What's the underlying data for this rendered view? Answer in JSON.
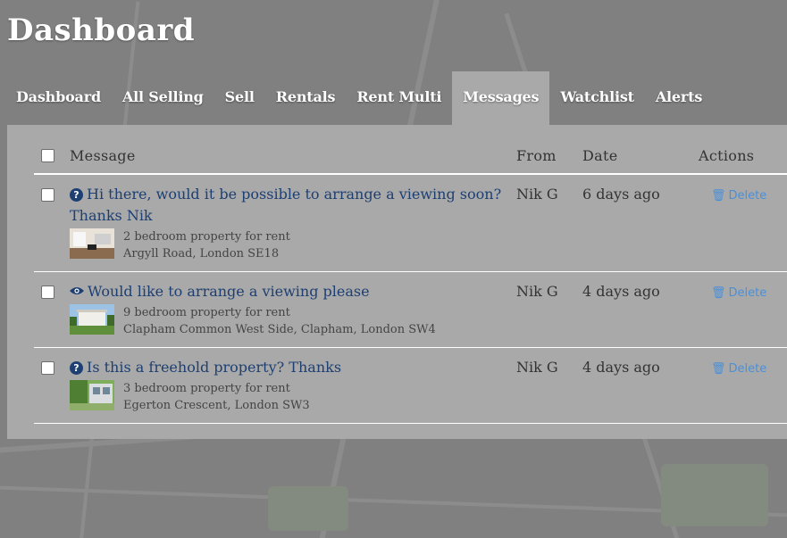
{
  "page": {
    "title": "Dashboard"
  },
  "tabs": [
    {
      "label": "Dashboard"
    },
    {
      "label": "All Selling"
    },
    {
      "label": "Sell"
    },
    {
      "label": "Rentals"
    },
    {
      "label": "Rent Multi"
    },
    {
      "label": "Messages",
      "active": true
    },
    {
      "label": "Watchlist"
    },
    {
      "label": "Alerts"
    }
  ],
  "table": {
    "headers": {
      "message": "Message",
      "from": "From",
      "date": "Date",
      "actions": "Actions"
    },
    "rows": [
      {
        "icon": "question-circle-icon",
        "subject": "Hi there, would it be possible to arrange a viewing soon? Thanks Nik",
        "property_type": "2 bedroom property for rent",
        "address": "Argyll Road, London SE18",
        "from": "Nik G",
        "date": "6 days ago",
        "action": "Delete"
      },
      {
        "icon": "eye-icon",
        "subject": "Would like to arrange a viewing please",
        "property_type": "9 bedroom property for rent",
        "address": "Clapham Common West Side, Clapham, London SW4",
        "from": "Nik G",
        "date": "4 days ago",
        "action": "Delete"
      },
      {
        "icon": "question-circle-icon",
        "subject": "Is this a freehold property? Thanks",
        "property_type": "3 bedroom property for rent",
        "address": "Egerton Crescent, London SW3",
        "from": "Nik G",
        "date": "4 days ago",
        "action": "Delete"
      }
    ]
  },
  "colors": {
    "link": "#1d3f72",
    "delete": "#4a90d9",
    "panel": "#a9a9a9"
  }
}
